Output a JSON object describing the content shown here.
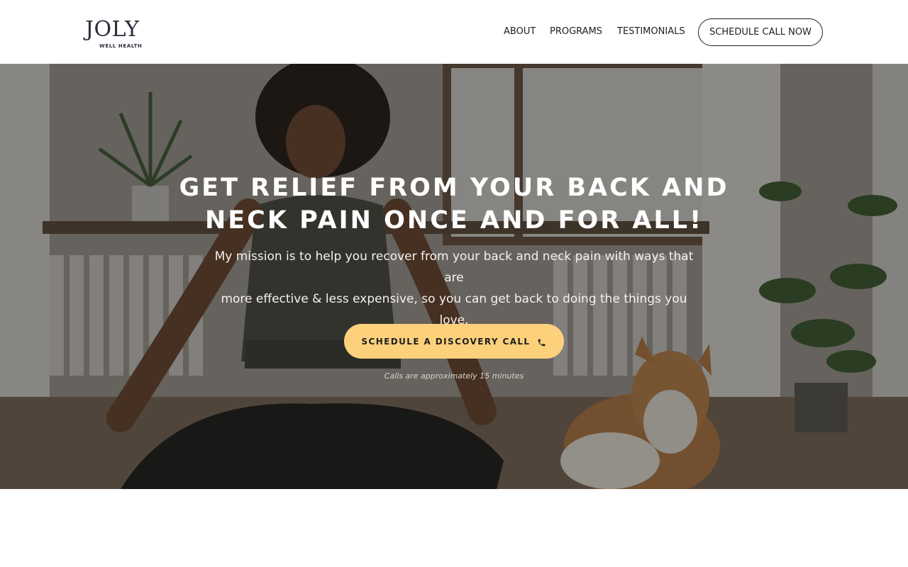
{
  "brand": {
    "logo_text": "JOLY",
    "logo_subtitle": "WELL HEALTH"
  },
  "nav": {
    "items": [
      {
        "label": "ABOUT"
      },
      {
        "label": "PROGRAMS"
      },
      {
        "label": "TESTIMONIALS"
      }
    ],
    "cta_label": "SCHEDULE CALL NOW"
  },
  "hero": {
    "headline_line1": "GET RELIEF FROM YOUR BACK AND",
    "headline_line2": "NECK PAIN ONCE AND FOR ALL!",
    "subtext_line1": "My mission is to help you recover from your back and neck pain with ways that are",
    "subtext_line2": "more effective & less expensive, so you can get back to doing the things you love.",
    "cta_label": "SCHEDULE A DISCOVERY CALL",
    "cta_icon": "phone-icon",
    "note": "Calls are approximately 15 minutes"
  },
  "colors": {
    "cta_background": "#fdd17c",
    "text_dark": "#1f1f1f",
    "brand": "#2b2b3a"
  }
}
